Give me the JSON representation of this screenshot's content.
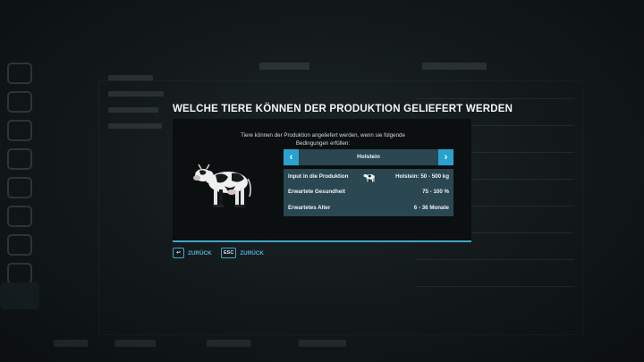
{
  "dialog": {
    "title": "WELCHE TIERE KÖNNEN DER PRODUKTION GELIEFERT WERDEN",
    "info_line1": "Tiere können der Produktion angeliefert werden, wenn sie folgende",
    "info_line2": "Bedingungen erfüllen:",
    "selector": {
      "prev_symbol": "‹",
      "value": "Holstein",
      "next_symbol": "›"
    },
    "rows": [
      {
        "label": "Input in die Produktion",
        "icon": "cow-mini-icon",
        "value": "Holstein: 50 - 500 kg"
      },
      {
        "label": "Erwartete Gesundheit",
        "value": "75 - 100 %"
      },
      {
        "label": "Erwartetes Alter",
        "value": "6 - 36 Monate"
      }
    ],
    "animal_icon": "holstein-cow-image",
    "accent_color": "#3fa7c8"
  },
  "buttons": {
    "back_key_symbol": "↩",
    "back_label": "ZURÜCK",
    "esc_key": "ESC",
    "esc_label": "ZURÜCK"
  }
}
